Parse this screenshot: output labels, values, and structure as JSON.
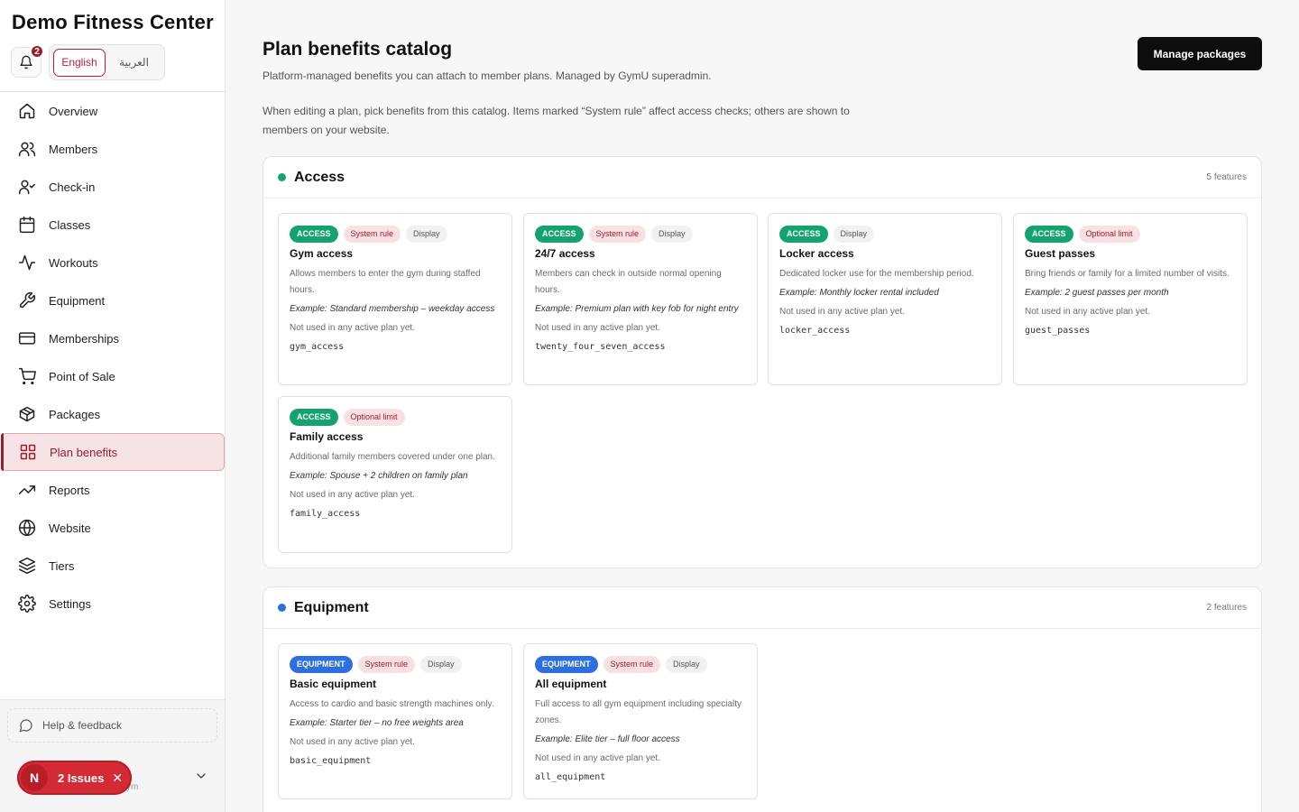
{
  "sidebar": {
    "brand": "Demo Fitness Center",
    "notifications_count": "2",
    "languages": [
      "English",
      "العربية"
    ],
    "nav": [
      {
        "label": "Overview",
        "icon": "home-icon"
      },
      {
        "label": "Members",
        "icon": "users-icon"
      },
      {
        "label": "Check-in",
        "icon": "user-check-icon"
      },
      {
        "label": "Classes",
        "icon": "calendar-icon"
      },
      {
        "label": "Workouts",
        "icon": "activity-icon"
      },
      {
        "label": "Equipment",
        "icon": "wrench-icon"
      },
      {
        "label": "Memberships",
        "icon": "credit-card-icon"
      },
      {
        "label": "Point of Sale",
        "icon": "cart-icon"
      },
      {
        "label": "Packages",
        "icon": "package-icon"
      },
      {
        "label": "Plan benefits",
        "icon": "grid-icon",
        "active": true
      },
      {
        "label": "Reports",
        "icon": "trending-up-icon"
      },
      {
        "label": "Website",
        "icon": "globe-icon"
      },
      {
        "label": "Tiers",
        "icon": "layers-icon"
      },
      {
        "label": "Settings",
        "icon": "gear-icon"
      }
    ],
    "help_label": "Help & feedback",
    "user_sub": "ym",
    "issues": {
      "avatar": "N",
      "label": "2 Issues"
    }
  },
  "main": {
    "title": "Plan benefits catalog",
    "subtitle": "Platform-managed benefits you can attach to member plans. Managed by GymU superadmin.",
    "description": "When editing a plan, pick benefits from this catalog. Items marked “System rule” affect access checks; others are shown to members on your website.",
    "manage_button": "Manage packages"
  },
  "sections": [
    {
      "title": "Access",
      "count": "5 features",
      "color": "#14a36f",
      "cards": [
        {
          "category": "ACCESS",
          "tags": [
            "System rule",
            "Display"
          ],
          "title": "Gym access",
          "desc": "Allows members to enter the gym during staffed hours.",
          "example": "Example: Standard membership – weekday access",
          "used": "Not used in any active plan yet.",
          "key": "gym_access"
        },
        {
          "category": "ACCESS",
          "tags": [
            "System rule",
            "Display"
          ],
          "title": "24/7 access",
          "desc": "Members can check in outside normal opening hours.",
          "example": "Example: Premium plan with key fob for night entry",
          "used": "Not used in any active plan yet.",
          "key": "twenty_four_seven_access"
        },
        {
          "category": "ACCESS",
          "tags": [
            "Display"
          ],
          "title": "Locker access",
          "desc": "Dedicated locker use for the membership period.",
          "example": "Example: Monthly locker rental included",
          "used": "Not used in any active plan yet.",
          "key": "locker_access"
        },
        {
          "category": "ACCESS",
          "tags": [
            "Optional limit"
          ],
          "title": "Guest passes",
          "desc": "Bring friends or family for a limited number of visits.",
          "example": "Example: 2 guest passes per month",
          "used": "Not used in any active plan yet.",
          "key": "guest_passes"
        },
        {
          "category": "ACCESS",
          "tags": [
            "Optional limit"
          ],
          "title": "Family access",
          "desc": "Additional family members covered under one plan.",
          "example": "Example: Spouse + 2 children on family plan",
          "used": "Not used in any active plan yet.",
          "key": "family_access"
        }
      ]
    },
    {
      "title": "Equipment",
      "count": "2 features",
      "color": "#2d6fe0",
      "cards": [
        {
          "category": "EQUIPMENT",
          "tags": [
            "System rule",
            "Display"
          ],
          "title": "Basic equipment",
          "desc": "Access to cardio and basic strength machines only.",
          "example": "Example: Starter tier – no free weights area",
          "used": "Not used in any active plan yet.",
          "key": "basic_equipment"
        },
        {
          "category": "EQUIPMENT",
          "tags": [
            "System rule",
            "Display"
          ],
          "title": "All equipment",
          "desc": "Full access to all gym equipment including specialty zones.",
          "example": "Example: Elite tier – full floor access",
          "used": "Not used in any active plan yet.",
          "key": "all_equipment"
        }
      ]
    }
  ]
}
